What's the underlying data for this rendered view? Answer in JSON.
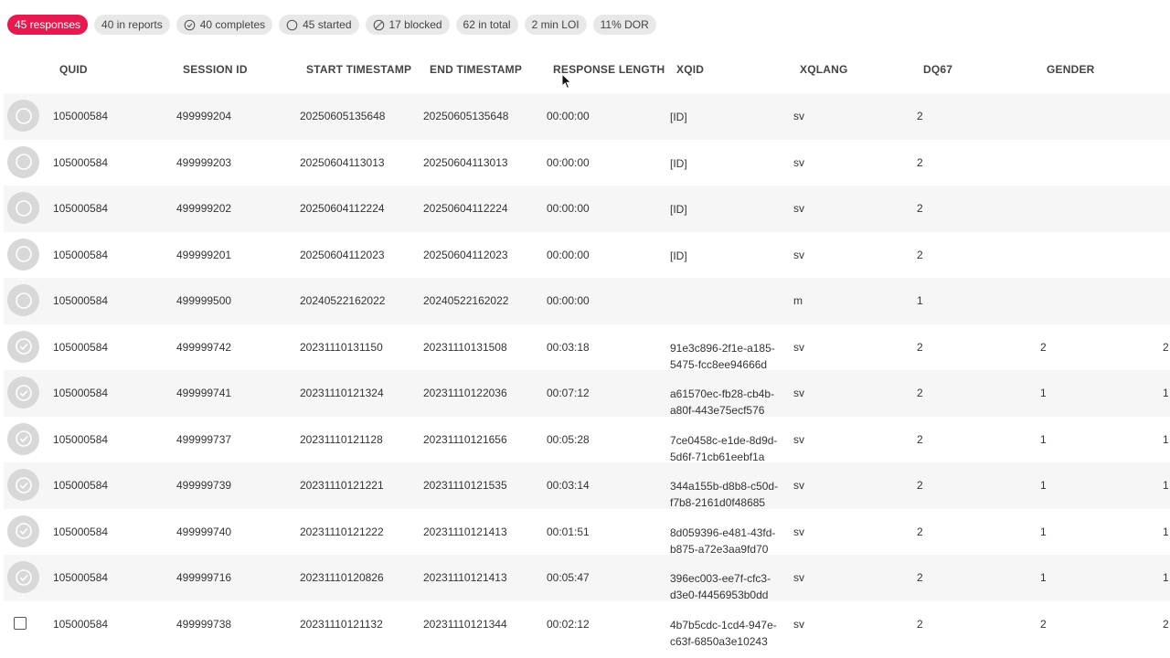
{
  "filters": [
    {
      "label": "45 responses",
      "icon": "",
      "active": true
    },
    {
      "label": "40 in reports",
      "icon": "",
      "active": false
    },
    {
      "label": "40 completes",
      "icon": "check-circle-icon",
      "active": false
    },
    {
      "label": "45 started",
      "icon": "circle-icon",
      "active": false
    },
    {
      "label": "17 blocked",
      "icon": "blocked-icon",
      "active": false
    },
    {
      "label": "62 in total",
      "icon": "",
      "active": false
    },
    {
      "label": "2 min LOI",
      "icon": "",
      "active": false
    },
    {
      "label": "11% DOR",
      "icon": "",
      "active": false
    }
  ],
  "table": {
    "columns": [
      "QUID",
      "SESSION ID",
      "START TIMESTAMP",
      "END TIMESTAMP",
      "RESPONSE LENGTH",
      "XQID",
      "XQLANG",
      "DQ67",
      "GENDER"
    ],
    "rows": [
      {
        "status": "started",
        "quid": "105000584",
        "session": "499999204",
        "start": "20250605135648",
        "end": "20250605135648",
        "length": "00:00:00",
        "xqid": "[ID]",
        "lang": "sv",
        "dq67": "2",
        "gender": "",
        "extra": ""
      },
      {
        "status": "started",
        "quid": "105000584",
        "session": "499999203",
        "start": "20250604113013",
        "end": "20250604113013",
        "length": "00:00:00",
        "xqid": "[ID]",
        "lang": "sv",
        "dq67": "2",
        "gender": "",
        "extra": ""
      },
      {
        "status": "started",
        "quid": "105000584",
        "session": "499999202",
        "start": "20250604112224",
        "end": "20250604112224",
        "length": "00:00:00",
        "xqid": "[ID]",
        "lang": "sv",
        "dq67": "2",
        "gender": "",
        "extra": ""
      },
      {
        "status": "started",
        "quid": "105000584",
        "session": "499999201",
        "start": "20250604112023",
        "end": "20250604112023",
        "length": "00:00:00",
        "xqid": "[ID]",
        "lang": "sv",
        "dq67": "2",
        "gender": "",
        "extra": ""
      },
      {
        "status": "started",
        "quid": "105000584",
        "session": "499999500",
        "start": "20240522162022",
        "end": "20240522162022",
        "length": "00:00:00",
        "xqid": "",
        "lang": "m",
        "dq67": "1",
        "gender": "",
        "extra": ""
      },
      {
        "status": "complete",
        "quid": "105000584",
        "session": "499999742",
        "start": "20231110131150",
        "end": "20231110131508",
        "length": "00:03:18",
        "xqid": "91e3c896-2f1e-a185-5475-fcc8ee94666d",
        "lang": "sv",
        "dq67": "2",
        "gender": "2",
        "extra": "2"
      },
      {
        "status": "complete",
        "quid": "105000584",
        "session": "499999741",
        "start": "20231110121324",
        "end": "20231110122036",
        "length": "00:07:12",
        "xqid": "a61570ec-fb28-cb4b-a80f-443e75ecf576",
        "lang": "sv",
        "dq67": "2",
        "gender": "1",
        "extra": "1"
      },
      {
        "status": "complete",
        "quid": "105000584",
        "session": "499999737",
        "start": "20231110121128",
        "end": "20231110121656",
        "length": "00:05:28",
        "xqid": "7ce0458c-e1de-8d9d-5d6f-71cb61eebf1a",
        "lang": "sv",
        "dq67": "2",
        "gender": "1",
        "extra": "1"
      },
      {
        "status": "complete",
        "quid": "105000584",
        "session": "499999739",
        "start": "20231110121221",
        "end": "20231110121535",
        "length": "00:03:14",
        "xqid": "344a155b-d8b8-c50d-f7b8-2161d0f48685",
        "lang": "sv",
        "dq67": "2",
        "gender": "1",
        "extra": "1"
      },
      {
        "status": "complete",
        "quid": "105000584",
        "session": "499999740",
        "start": "20231110121222",
        "end": "20231110121413",
        "length": "00:01:51",
        "xqid": "8d059396-e481-43fd-b875-a72e3aa9fd70",
        "lang": "sv",
        "dq67": "2",
        "gender": "1",
        "extra": "1"
      },
      {
        "status": "complete",
        "quid": "105000584",
        "session": "499999716",
        "start": "20231110120826",
        "end": "20231110121413",
        "length": "00:05:47",
        "xqid": "396ec003-ee7f-cfc3-d3e0-f4456953b0dd",
        "lang": "sv",
        "dq67": "2",
        "gender": "1",
        "extra": "1"
      },
      {
        "status": "checkbox",
        "quid": "105000584",
        "session": "499999738",
        "start": "20231110121132",
        "end": "20231110121344",
        "length": "00:02:12",
        "xqid": "4b7b5cdc-1cd4-947e-c63f-6850a3e10243",
        "lang": "sv",
        "dq67": "2",
        "gender": "2",
        "extra": "2"
      }
    ]
  },
  "colors": {
    "accent": "#e8194e",
    "chip_bg": "#e8e8e8",
    "row_alt": "#f6f6f6",
    "status_bg": "#d8d8d8"
  }
}
